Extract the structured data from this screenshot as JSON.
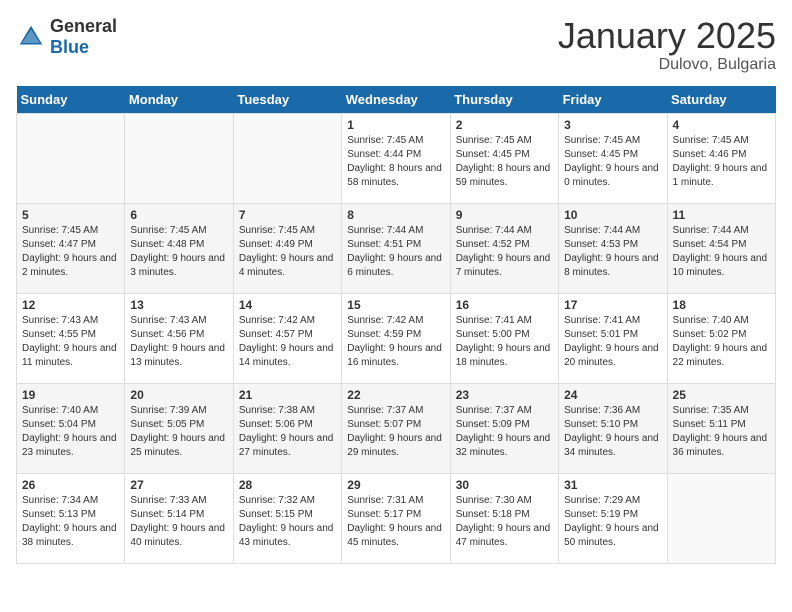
{
  "logo": {
    "text_general": "General",
    "text_blue": "Blue"
  },
  "header": {
    "month": "January 2025",
    "location": "Dulovo, Bulgaria"
  },
  "days_of_week": [
    "Sunday",
    "Monday",
    "Tuesday",
    "Wednesday",
    "Thursday",
    "Friday",
    "Saturday"
  ],
  "weeks": [
    [
      {
        "day": "",
        "info": ""
      },
      {
        "day": "",
        "info": ""
      },
      {
        "day": "",
        "info": ""
      },
      {
        "day": "1",
        "info": "Sunrise: 7:45 AM\nSunset: 4:44 PM\nDaylight: 8 hours and 58 minutes."
      },
      {
        "day": "2",
        "info": "Sunrise: 7:45 AM\nSunset: 4:45 PM\nDaylight: 8 hours and 59 minutes."
      },
      {
        "day": "3",
        "info": "Sunrise: 7:45 AM\nSunset: 4:45 PM\nDaylight: 9 hours and 0 minutes."
      },
      {
        "day": "4",
        "info": "Sunrise: 7:45 AM\nSunset: 4:46 PM\nDaylight: 9 hours and 1 minute."
      }
    ],
    [
      {
        "day": "5",
        "info": "Sunrise: 7:45 AM\nSunset: 4:47 PM\nDaylight: 9 hours and 2 minutes."
      },
      {
        "day": "6",
        "info": "Sunrise: 7:45 AM\nSunset: 4:48 PM\nDaylight: 9 hours and 3 minutes."
      },
      {
        "day": "7",
        "info": "Sunrise: 7:45 AM\nSunset: 4:49 PM\nDaylight: 9 hours and 4 minutes."
      },
      {
        "day": "8",
        "info": "Sunrise: 7:44 AM\nSunset: 4:51 PM\nDaylight: 9 hours and 6 minutes."
      },
      {
        "day": "9",
        "info": "Sunrise: 7:44 AM\nSunset: 4:52 PM\nDaylight: 9 hours and 7 minutes."
      },
      {
        "day": "10",
        "info": "Sunrise: 7:44 AM\nSunset: 4:53 PM\nDaylight: 9 hours and 8 minutes."
      },
      {
        "day": "11",
        "info": "Sunrise: 7:44 AM\nSunset: 4:54 PM\nDaylight: 9 hours and 10 minutes."
      }
    ],
    [
      {
        "day": "12",
        "info": "Sunrise: 7:43 AM\nSunset: 4:55 PM\nDaylight: 9 hours and 11 minutes."
      },
      {
        "day": "13",
        "info": "Sunrise: 7:43 AM\nSunset: 4:56 PM\nDaylight: 9 hours and 13 minutes."
      },
      {
        "day": "14",
        "info": "Sunrise: 7:42 AM\nSunset: 4:57 PM\nDaylight: 9 hours and 14 minutes."
      },
      {
        "day": "15",
        "info": "Sunrise: 7:42 AM\nSunset: 4:59 PM\nDaylight: 9 hours and 16 minutes."
      },
      {
        "day": "16",
        "info": "Sunrise: 7:41 AM\nSunset: 5:00 PM\nDaylight: 9 hours and 18 minutes."
      },
      {
        "day": "17",
        "info": "Sunrise: 7:41 AM\nSunset: 5:01 PM\nDaylight: 9 hours and 20 minutes."
      },
      {
        "day": "18",
        "info": "Sunrise: 7:40 AM\nSunset: 5:02 PM\nDaylight: 9 hours and 22 minutes."
      }
    ],
    [
      {
        "day": "19",
        "info": "Sunrise: 7:40 AM\nSunset: 5:04 PM\nDaylight: 9 hours and 23 minutes."
      },
      {
        "day": "20",
        "info": "Sunrise: 7:39 AM\nSunset: 5:05 PM\nDaylight: 9 hours and 25 minutes."
      },
      {
        "day": "21",
        "info": "Sunrise: 7:38 AM\nSunset: 5:06 PM\nDaylight: 9 hours and 27 minutes."
      },
      {
        "day": "22",
        "info": "Sunrise: 7:37 AM\nSunset: 5:07 PM\nDaylight: 9 hours and 29 minutes."
      },
      {
        "day": "23",
        "info": "Sunrise: 7:37 AM\nSunset: 5:09 PM\nDaylight: 9 hours and 32 minutes."
      },
      {
        "day": "24",
        "info": "Sunrise: 7:36 AM\nSunset: 5:10 PM\nDaylight: 9 hours and 34 minutes."
      },
      {
        "day": "25",
        "info": "Sunrise: 7:35 AM\nSunset: 5:11 PM\nDaylight: 9 hours and 36 minutes."
      }
    ],
    [
      {
        "day": "26",
        "info": "Sunrise: 7:34 AM\nSunset: 5:13 PM\nDaylight: 9 hours and 38 minutes."
      },
      {
        "day": "27",
        "info": "Sunrise: 7:33 AM\nSunset: 5:14 PM\nDaylight: 9 hours and 40 minutes."
      },
      {
        "day": "28",
        "info": "Sunrise: 7:32 AM\nSunset: 5:15 PM\nDaylight: 9 hours and 43 minutes."
      },
      {
        "day": "29",
        "info": "Sunrise: 7:31 AM\nSunset: 5:17 PM\nDaylight: 9 hours and 45 minutes."
      },
      {
        "day": "30",
        "info": "Sunrise: 7:30 AM\nSunset: 5:18 PM\nDaylight: 9 hours and 47 minutes."
      },
      {
        "day": "31",
        "info": "Sunrise: 7:29 AM\nSunset: 5:19 PM\nDaylight: 9 hours and 50 minutes."
      },
      {
        "day": "",
        "info": ""
      }
    ]
  ]
}
